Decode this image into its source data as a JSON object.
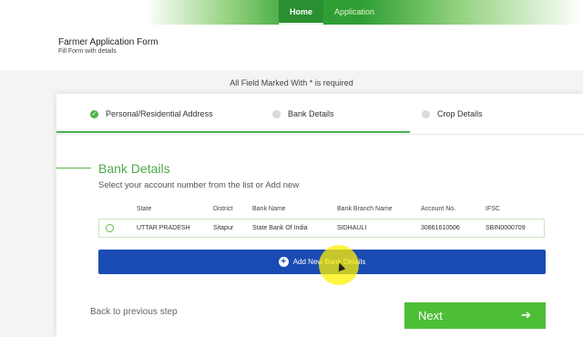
{
  "nav": {
    "items": [
      "Home",
      "Application"
    ],
    "active": "Home"
  },
  "form": {
    "title": "Farmer Application Form",
    "subtitle": "Fill Form with details"
  },
  "required_note": "All Field Marked With * is required",
  "steps": [
    {
      "label": "Personal/Residential Address",
      "status": "done"
    },
    {
      "label": "Bank Details",
      "status": "current"
    },
    {
      "label": "Crop Details",
      "status": "pending"
    }
  ],
  "section": {
    "title": "Bank Details",
    "subtitle": "Select your account number from the list or Add new"
  },
  "table": {
    "headers": [
      "State",
      "District",
      "Bank Name",
      "Bank Branch Name",
      "Account No.",
      "IFSC"
    ],
    "rows": [
      [
        "UTTAR PRADESH",
        "Sitapur",
        "State Bank Of India",
        "SIDHAULI",
        "30861610506",
        "SBIN0000709"
      ]
    ]
  },
  "buttons": {
    "add_bank": "Add New Bank Details",
    "back": "Back to previous step",
    "next": "Next"
  },
  "colors": {
    "brand_green": "#2f9e35",
    "accent_green": "#4dbf37",
    "primary_blue": "#1a4bb3"
  },
  "icons": {
    "step_done": "check-icon",
    "add": "plus-circle-icon",
    "next": "arrow-right-icon"
  }
}
